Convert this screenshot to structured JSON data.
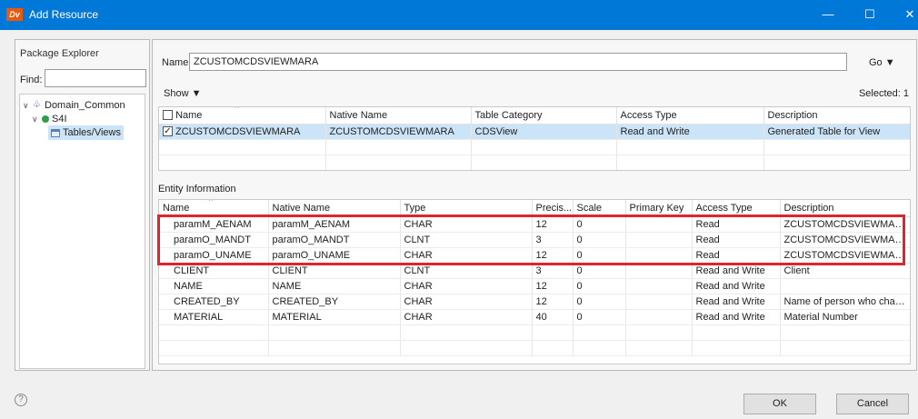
{
  "window": {
    "logo": "Dv",
    "title": "Add Resource",
    "minimize": "—",
    "maximize": "☐",
    "close": "✕"
  },
  "package_explorer": {
    "header": "Package Explorer",
    "find_label": "Find:",
    "find_value": "",
    "tree": [
      {
        "label": "Domain_Common",
        "icon": "domain-icon",
        "expanded": true
      },
      {
        "label": "S4I",
        "icon": "database-icon",
        "expanded": true
      },
      {
        "label": "Tables/Views",
        "icon": "table-icon",
        "selected": true
      }
    ]
  },
  "resource": {
    "name_label": "Name:",
    "name_value": "ZCUSTOMCDSVIEWMARA",
    "go_label": "Go",
    "show_label": "Show",
    "selected_label": "Selected: 1",
    "columns": [
      "Name",
      "Native Name",
      "Table Category",
      "Access Type",
      "Description"
    ],
    "rows": [
      {
        "checked": true,
        "name": "ZCUSTOMCDSVIEWMARA",
        "native": "ZCUSTOMCDSVIEWMARA",
        "category": "CDSView",
        "access": "Read and Write",
        "description": "Generated Table for View"
      }
    ]
  },
  "entity": {
    "label": "Entity Information",
    "columns": [
      "Name",
      "Native Name",
      "Type",
      "Precis...",
      "Scale",
      "Primary Key",
      "Access Type",
      "Description"
    ],
    "rows": [
      [
        "paramM_AENAM",
        "paramM_AENAM",
        "CHAR",
        "12",
        "0",
        "",
        "Read",
        "ZCUSTOMCDSVIEWMARA"
      ],
      [
        "paramO_MANDT",
        "paramO_MANDT",
        "CLNT",
        "3",
        "0",
        "",
        "Read",
        "ZCUSTOMCDSVIEWMARA"
      ],
      [
        "paramO_UNAME",
        "paramO_UNAME",
        "CHAR",
        "12",
        "0",
        "",
        "Read",
        "ZCUSTOMCDSVIEWMARA"
      ],
      [
        "CLIENT",
        "CLIENT",
        "CLNT",
        "3",
        "0",
        "",
        "Read and Write",
        "Client"
      ],
      [
        "NAME",
        "NAME",
        "CHAR",
        "12",
        "0",
        "",
        "Read and Write",
        ""
      ],
      [
        "CREATED_BY",
        "CREATED_BY",
        "CHAR",
        "12",
        "0",
        "",
        "Read and Write",
        "Name of person who chan..."
      ],
      [
        "MATERIAL",
        "MATERIAL",
        "CHAR",
        "40",
        "0",
        "",
        "Read and Write",
        "Material Number"
      ]
    ]
  },
  "footer": {
    "help": "?",
    "ok_label": "OK",
    "cancel_label": "Cancel"
  },
  "colors": {
    "titlebar": "#0078d7",
    "selection": "#cce4f7",
    "highlight": "#e0242b"
  }
}
